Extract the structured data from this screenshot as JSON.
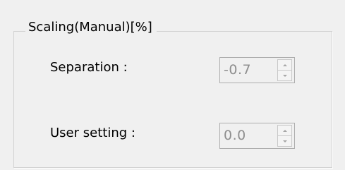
{
  "group": {
    "title": "Scaling(Manual)[%]"
  },
  "fields": {
    "separation": {
      "label": "Separation :",
      "value": "-0.7"
    },
    "user_setting": {
      "label": "User setting :",
      "value": "0.0"
    }
  },
  "icons": {
    "spin_up": "spin-up-arrow-icon",
    "spin_down": "spin-down-arrow-icon"
  },
  "colors": {
    "background": "#f0f0f0",
    "frame_border": "#d2d2d2",
    "disabled_text": "#8e8e8e",
    "input_border": "#adadad"
  },
  "state": {
    "inputs_enabled": false
  }
}
